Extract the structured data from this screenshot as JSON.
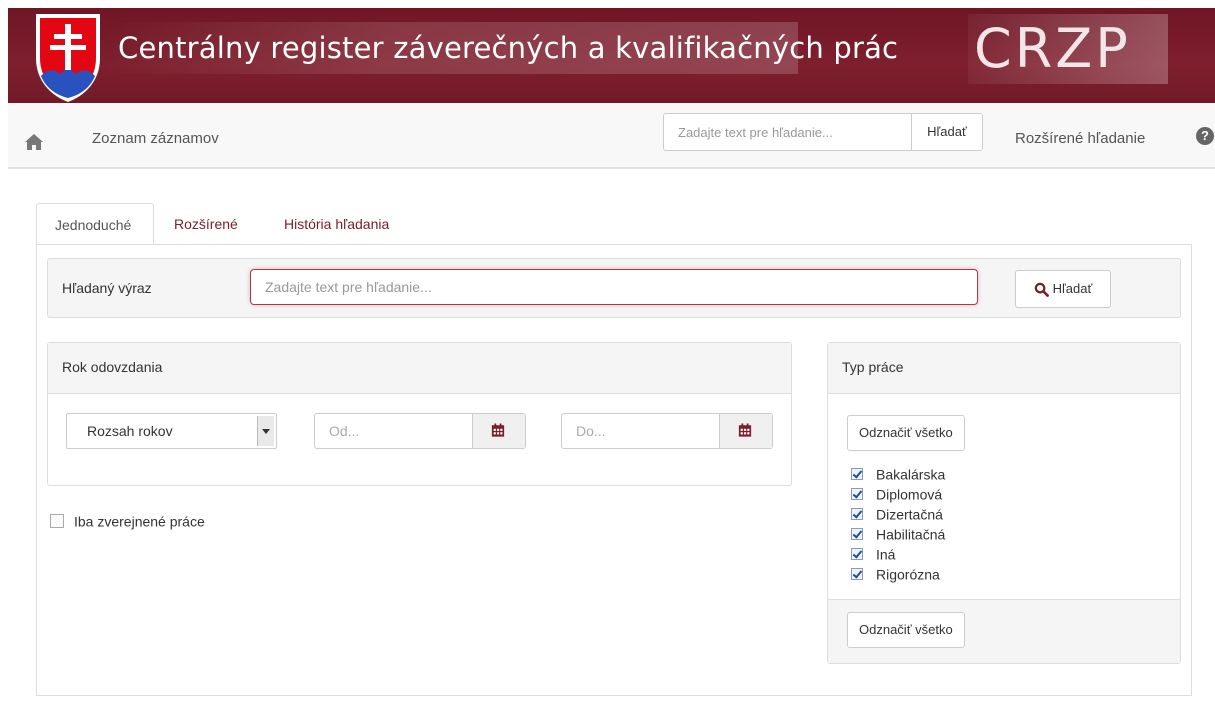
{
  "header": {
    "title": "Centrálny register záverečných a kvalifikačných prác",
    "brand": "CRZP"
  },
  "nav": {
    "home_icon": "home-icon",
    "records_link": "Zoznam záznamov",
    "search_placeholder": "Zadajte text pre hľadanie...",
    "search_button": "Hľadať",
    "advanced_link": "Rozšírené hľadanie",
    "help_icon": "question-circle-icon",
    "help_glyph": "?"
  },
  "tabs": [
    {
      "label": "Jednoduché",
      "active": true
    },
    {
      "label": "Rozšírené",
      "active": false
    },
    {
      "label": "História hľadania",
      "active": false
    }
  ],
  "search": {
    "label": "Hľadaný výraz",
    "placeholder": "Zadajte text pre hľadanie...",
    "button": "Hľadať"
  },
  "year": {
    "title": "Rok odovzdania",
    "range_select": "Rozsah rokov",
    "from_placeholder": "Od...",
    "to_placeholder": "Do..."
  },
  "published_only": {
    "label": "Iba zverejnené práce",
    "checked": false
  },
  "type": {
    "title": "Typ práce",
    "toggle_top": "Odznačiť všetko",
    "toggle_bottom": "Odznačiť všetko",
    "items": [
      {
        "label": "Bakalárska",
        "checked": true
      },
      {
        "label": "Diplomová",
        "checked": true
      },
      {
        "label": "Dizertačná",
        "checked": true
      },
      {
        "label": "Habilitačná",
        "checked": true
      },
      {
        "label": "Iná",
        "checked": true
      },
      {
        "label": "Rigorózna",
        "checked": true
      }
    ]
  },
  "colors": {
    "brand": "#7a1c2b",
    "link": "#7a1c2b"
  }
}
